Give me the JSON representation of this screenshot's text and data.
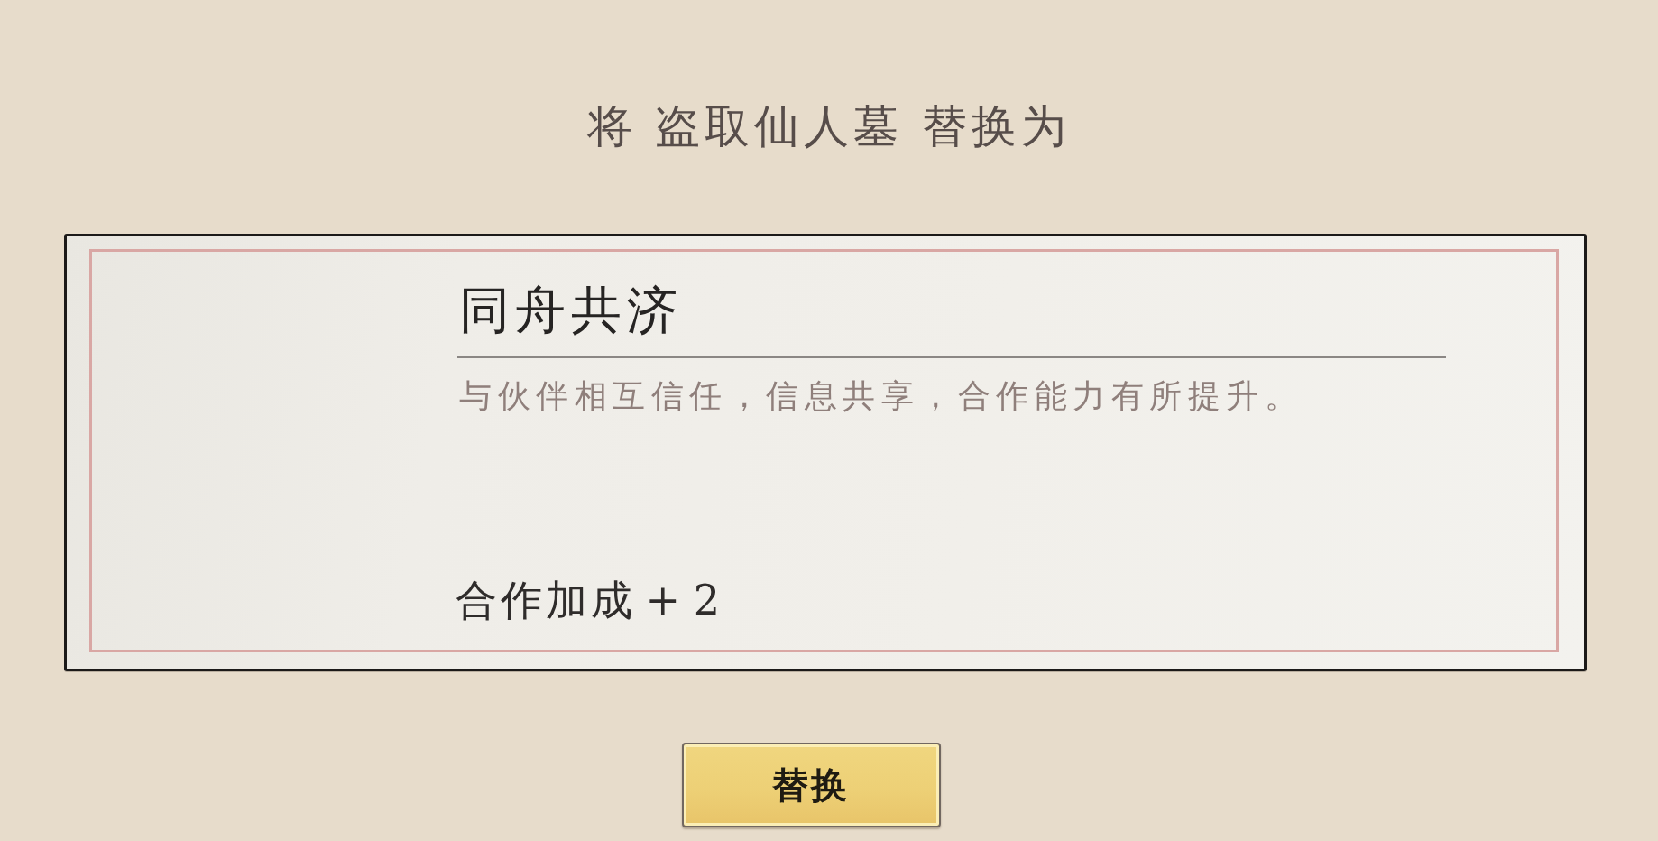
{
  "title": "将 盗取仙人墓 替换为",
  "card": {
    "name": "同舟共济",
    "description": "与伙伴相互信任，信息共享，合作能力有所提升。",
    "bonus": "合作加成 + 2"
  },
  "buttons": [
    {
      "label": "替换"
    }
  ]
}
